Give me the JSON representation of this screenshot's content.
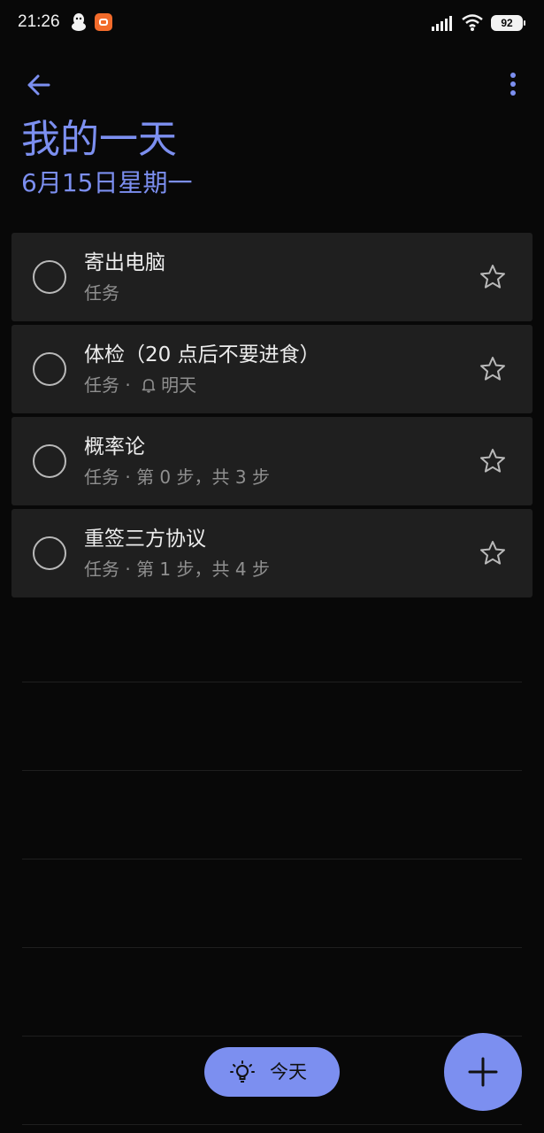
{
  "status_bar": {
    "time": "21:26",
    "battery": "92",
    "icons": [
      "qq-icon",
      "app-notification-icon",
      "signal-icon",
      "wifi-icon",
      "battery-icon"
    ]
  },
  "header": {
    "title": "我的一天",
    "date": "6月15日星期一",
    "back_icon": "arrow-left-icon",
    "more_icon": "more-vertical-icon"
  },
  "tasks": [
    {
      "title": "寄出电脑",
      "list": "任务",
      "detail": "",
      "has_reminder": false
    },
    {
      "title": "体检（20 点后不要进食）",
      "list": "任务",
      "detail": "明天",
      "has_reminder": true
    },
    {
      "title": "概率论",
      "list": "任务",
      "detail": "第 0 步，共 3 步",
      "has_reminder": false
    },
    {
      "title": "重签三方协议",
      "list": "任务",
      "detail": "第 1 步，共 4 步",
      "has_reminder": false
    }
  ],
  "separator": " · ",
  "footer": {
    "today_label": "今天",
    "today_icon": "lightbulb-icon",
    "add_icon": "plus-icon"
  },
  "colors": {
    "accent": "#7c8ff0",
    "background": "#080808",
    "card": "#1f1f1f",
    "text_primary": "#ececec",
    "text_secondary": "#8f8f8f"
  }
}
